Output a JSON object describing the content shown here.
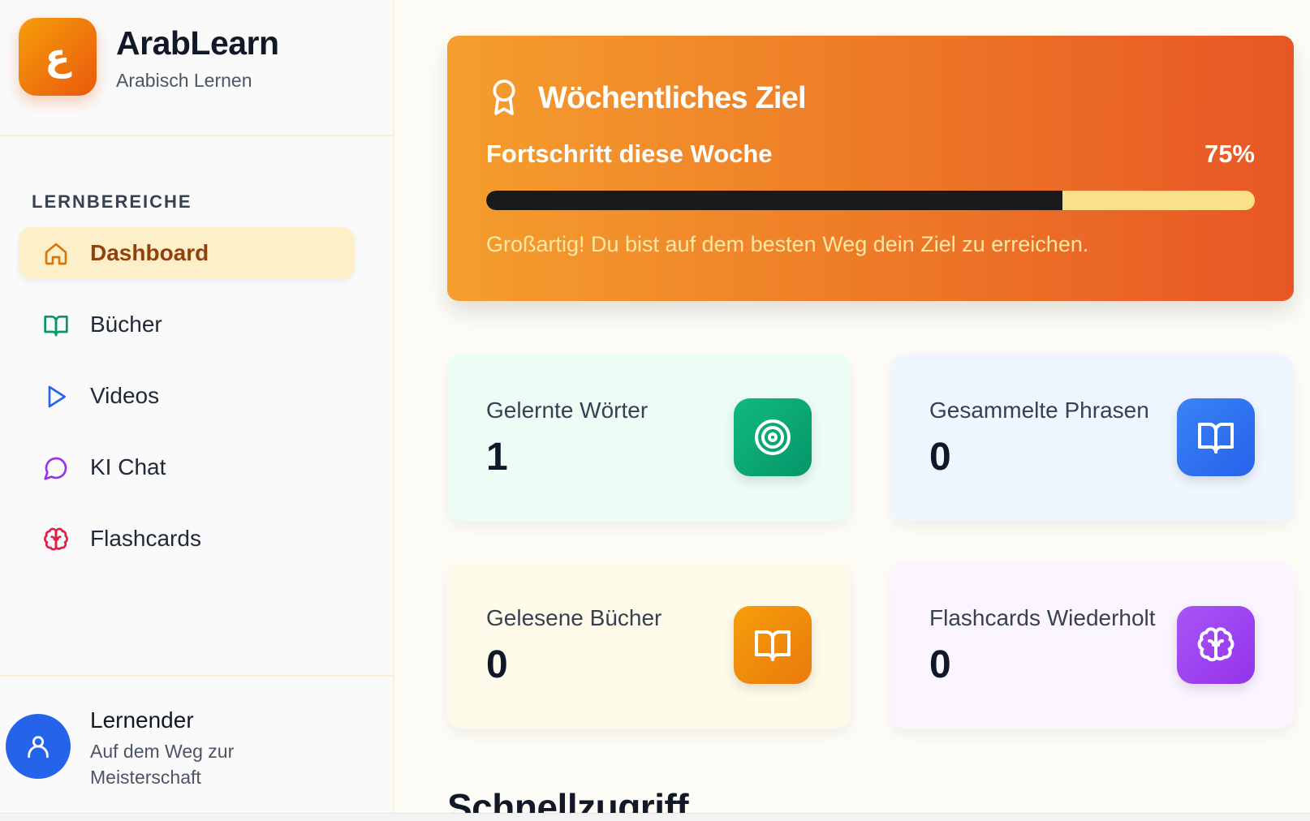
{
  "brand": {
    "logo_glyph": "ع",
    "title": "ArabLearn",
    "subtitle": "Arabisch Lernen"
  },
  "sidebar": {
    "section_label": "LERNBEREICHE",
    "items": [
      {
        "label": "Dashboard",
        "icon": "home-icon",
        "color": "#d97706",
        "active": true
      },
      {
        "label": "Bücher",
        "icon": "book-open-icon",
        "color": "#059669",
        "active": false
      },
      {
        "label": "Videos",
        "icon": "play-icon",
        "color": "#2563eb",
        "active": false
      },
      {
        "label": "KI Chat",
        "icon": "chat-bubble-icon",
        "color": "#9333ea",
        "active": false
      },
      {
        "label": "Flashcards",
        "icon": "brain-icon",
        "color": "#e11d48",
        "active": false
      }
    ]
  },
  "user": {
    "name": "Lernender",
    "subtitle": "Auf dem Weg zur Meisterschaft",
    "icon": "user-icon"
  },
  "goal": {
    "icon": "award-icon",
    "title": "Wöchentliches Ziel",
    "progress_label": "Fortschritt diese Woche",
    "percent_text": "75%",
    "progress": 0.75,
    "message": "Großartig! Du bist auf dem besten Weg dein Ziel zu erreichen."
  },
  "stats": [
    {
      "label": "Gelernte Wörter",
      "value": "1",
      "icon": "target-icon",
      "bg": "#ecfdf5",
      "icon_from": "#10b981",
      "icon_to": "#059669"
    },
    {
      "label": "Gesammelte Phrasen",
      "value": "0",
      "icon": "book-open-icon",
      "bg": "#eff6ff",
      "icon_from": "#3b82f6",
      "icon_to": "#2563eb"
    },
    {
      "label": "Gelesene Bücher",
      "value": "0",
      "icon": "book-open-icon",
      "bg": "#fffbeb",
      "icon_from": "#f59e0b",
      "icon_to": "#ea7a0c"
    },
    {
      "label": "Flashcards Wiederholt",
      "value": "0",
      "icon": "brain-icon",
      "bg": "#faf5ff",
      "icon_from": "#a855f7",
      "icon_to": "#9333ea"
    }
  ],
  "quick_access": {
    "title": "Schnellzugriff"
  }
}
